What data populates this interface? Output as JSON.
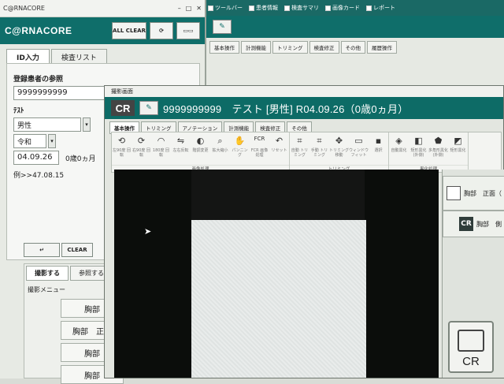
{
  "left": {
    "titlebar": "C@RNACORE",
    "brand": "C@RNACORE",
    "btn_all_clear": "ALL CLEAR",
    "tabs": [
      "ID入力",
      "検査リスト"
    ],
    "section_label": "登録患者の参照",
    "patient_id": "9999999999",
    "name_label": "ﾃｽﾄ",
    "sex": "男性",
    "era": "令和",
    "birthdate": "04.09.26",
    "age": "0歳0ヵ月",
    "example": "例>>47.08.15",
    "enter_label": "↵",
    "clear_label": "CLEAR",
    "bottom_tabs": [
      "撮影する",
      "参照する"
    ],
    "menu_label": "撮影メニュー",
    "menu_items": [
      "胸部",
      "胸部　正面",
      "胸部",
      "胸部"
    ]
  },
  "bg": {
    "checks": [
      "ツールバー",
      "患者情報",
      "検査サマリ",
      "画像カード",
      "レポート"
    ],
    "tabs": [
      "基本操作",
      "計測機能",
      "トリミング",
      "検査修正",
      "その他",
      "履歴操作"
    ]
  },
  "cr": {
    "window_title": "撮影画面",
    "badge": "CR",
    "patient_line": "9999999999　テスト [男性] R04.09.26（0歳0ヵ月）",
    "tabs": [
      "基本操作",
      "トリミング",
      "アノテーション",
      "計測機能",
      "検査修正",
      "その他"
    ],
    "toolbar_groups": [
      {
        "name": "画像処理",
        "items": [
          {
            "icon": "⟲",
            "label": "左90度 回転"
          },
          {
            "icon": "⟳",
            "label": "右90度 回転"
          },
          {
            "icon": "◠",
            "label": "180度 回転"
          },
          {
            "icon": "⇋",
            "label": "左右反転"
          },
          {
            "icon": "◐",
            "label": "階調変更"
          },
          {
            "icon": "⌕",
            "label": "拡大縮小"
          },
          {
            "icon": "✋",
            "label": "パンニング"
          },
          {
            "icon": "FCR",
            "label": "FCR 画像 処理"
          },
          {
            "icon": "↶",
            "label": "リセット"
          }
        ]
      },
      {
        "name": "トリミング",
        "items": [
          {
            "icon": "⌗",
            "label": "自動 トリミング"
          },
          {
            "icon": "⌗",
            "label": "手動 トリミング"
          },
          {
            "icon": "✥",
            "label": "トリミング 移動"
          },
          {
            "icon": "▭",
            "label": "ウィンドウ フィット"
          },
          {
            "icon": "▪",
            "label": "選択"
          }
        ]
      },
      {
        "name": "黒化処理",
        "items": [
          {
            "icon": "◈",
            "label": "自動黒化"
          },
          {
            "icon": "◧",
            "label": "矩形黒化 (外側)"
          },
          {
            "icon": "⬟",
            "label": "多角形黒化 (外側)"
          },
          {
            "icon": "◩",
            "label": "矩形黒化"
          }
        ]
      }
    ],
    "thumbs": [
      {
        "label": "胸部　正面（"
      },
      {
        "label": "胸部　側"
      }
    ],
    "big_button": "CR"
  },
  "colors": {
    "brand_teal": "#0f6e6a"
  }
}
